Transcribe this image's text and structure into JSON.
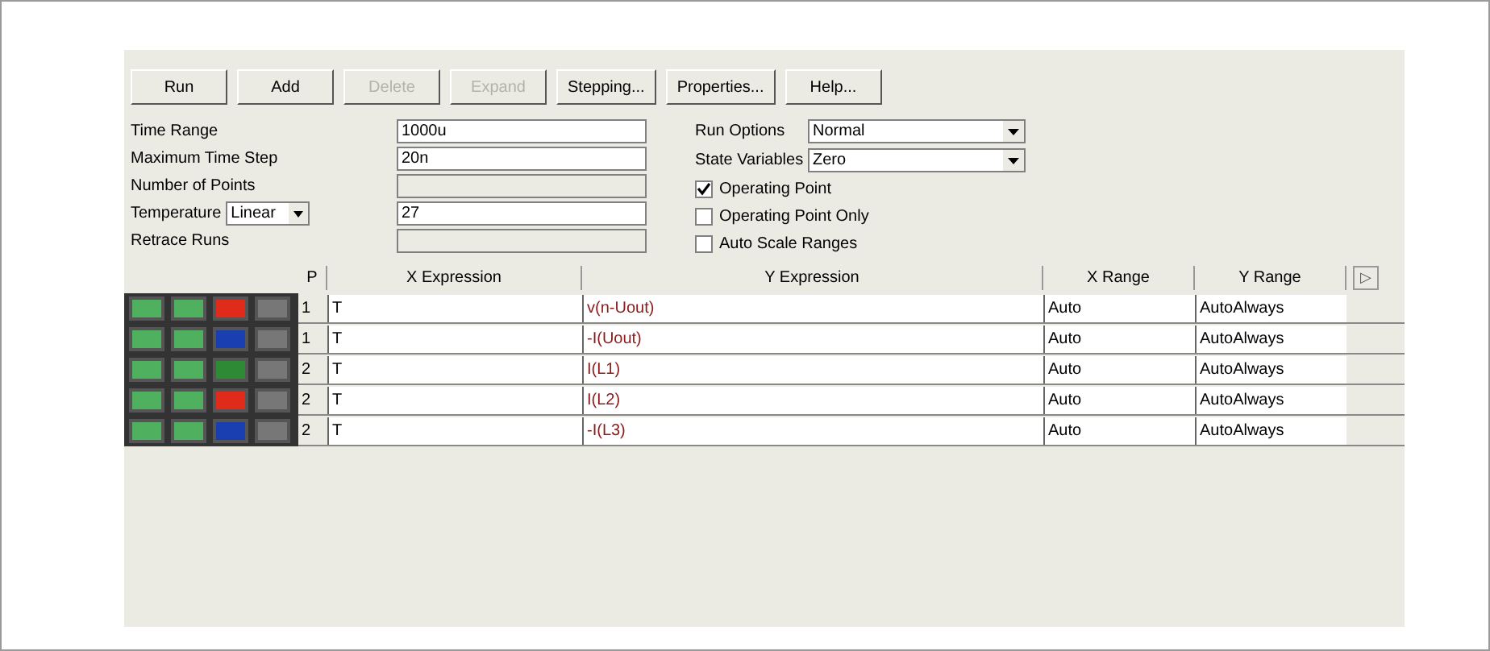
{
  "toolbar": [
    {
      "label": "Run",
      "disabled": false
    },
    {
      "label": "Add",
      "disabled": false
    },
    {
      "label": "Delete",
      "disabled": true
    },
    {
      "label": "Expand",
      "disabled": true
    },
    {
      "label": "Stepping...",
      "disabled": false
    },
    {
      "label": "Properties...",
      "disabled": false
    },
    {
      "label": "Help...",
      "disabled": false
    }
  ],
  "limits": [
    {
      "label": "Time Range",
      "value": "1000u",
      "disabled": false
    },
    {
      "label": "Maximum Time Step",
      "value": "20n",
      "disabled": false
    },
    {
      "label": "Number of Points",
      "disabled": true
    },
    {
      "label": "Temperature",
      "mode": "Linear",
      "value": "27",
      "disabled": false
    },
    {
      "label": "Retrace Runs",
      "disabled": true
    }
  ],
  "options": [
    {
      "label": "Run Options",
      "value": "Normal"
    },
    {
      "label": "State Variables",
      "value": "Zero"
    }
  ],
  "checkboxes": [
    {
      "label": "Operating Point",
      "checked": true
    },
    {
      "label": "Operating Point Only",
      "checked": false
    },
    {
      "label": "Auto Scale Ranges",
      "checked": false
    }
  ],
  "table": {
    "columns": [
      "P",
      "X Expression",
      "Y Expression",
      "X Range",
      "Y Range"
    ],
    "scroll_arrow": "▷",
    "rows": [
      {
        "color": "#e02a1a",
        "p": "1",
        "x": "T",
        "y": "v(n-Uout)",
        "x_range": "Auto",
        "y_range": "AutoAlways"
      },
      {
        "color": "#1a3fb0",
        "p": "1",
        "x": "T",
        "y": "-I(Uout)",
        "x_range": "Auto",
        "y_range": "AutoAlways"
      },
      {
        "color": "#2f8a35",
        "p": "2",
        "x": "T",
        "y": "I(L1)",
        "x_range": "Auto",
        "y_range": "AutoAlways"
      },
      {
        "color": "#e02a1a",
        "p": "2",
        "x": "T",
        "y": "I(L2)",
        "x_range": "Auto",
        "y_range": "AutoAlways"
      },
      {
        "color": "#1a3fb0",
        "p": "2",
        "x": "T",
        "y": "-I(L3)",
        "x_range": "Auto",
        "y_range": "AutoAlways"
      }
    ]
  }
}
